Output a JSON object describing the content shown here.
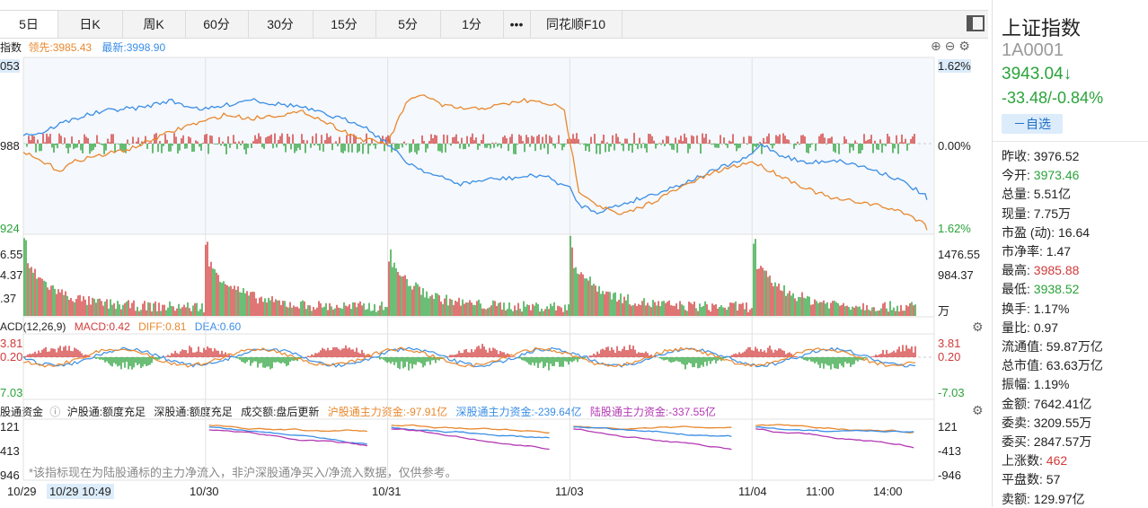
{
  "tabs": [
    "5日",
    "日K",
    "周K",
    "60分",
    "30分",
    "15分",
    "5分",
    "1分",
    "•••",
    "同花顺F10"
  ],
  "price_panel": {
    "legend_prefix": "指数",
    "lead_label": "领先:3985.43",
    "latest_label": "最新:3998.90",
    "y_left": [
      "053",
      "988",
      "924"
    ],
    "y_right": [
      "1.62%",
      "0.00%",
      "1.62%"
    ]
  },
  "volume_panel": {
    "y_left": [
      "6.55",
      "4.37",
      ".37"
    ],
    "y_right": [
      "1476.55",
      "984.37",
      "万"
    ],
    "unit": "万"
  },
  "macd_panel": {
    "title": "ACD(12,26,9)",
    "macd": "MACD:0.42",
    "diff": "DIFF:0.81",
    "dea": "DEA:0.60",
    "y_left": [
      "3.81",
      "0.20",
      "7.03"
    ],
    "y_right": [
      "3.81",
      "0.20",
      "-7.03"
    ]
  },
  "flow_panel": {
    "title": "股通资金",
    "sh_quota": "沪股通:额度充足",
    "sz_quota": "深股通:额度充足",
    "volume_note": "成交额:盘后更新",
    "sh_flow": "沪股通主力资金:-97.91亿",
    "sz_flow": "深股通主力资金:-239.64亿",
    "lgt_flow": "陆股通主力资金:-337.55亿",
    "y_left": [
      "121",
      "413",
      "946"
    ],
    "y_right": [
      "121",
      "-413",
      "-946"
    ],
    "note": "*该指标现在为陆股通标的主力净流入，非沪深股通净买入/净流入数据，仅供参考。"
  },
  "dates": [
    "10/29",
    "10/29 10:49",
    "10/30",
    "10/31",
    "11/03",
    "11/04",
    "11:00",
    "14:00"
  ],
  "quote": {
    "name": "上证指数",
    "code": "1A0001",
    "price": "3943.04↓",
    "change": "-33.48/-0.84%",
    "watch_button": "－自选",
    "stats": [
      {
        "label": "昨收:",
        "value": "3976.52",
        "tone": "plain"
      },
      {
        "label": "今开:",
        "value": "3973.46",
        "tone": "green"
      },
      {
        "label": "总量:",
        "value": "5.51亿",
        "tone": "plain"
      },
      {
        "label": "现量:",
        "value": "7.75万",
        "tone": "plain"
      },
      {
        "label": "市盈 (动):",
        "value": "16.64",
        "tone": "plain"
      },
      {
        "label": "市净率:",
        "value": "1.47",
        "tone": "plain"
      },
      {
        "label": "最高:",
        "value": "3985.88",
        "tone": "red"
      },
      {
        "label": "最低:",
        "value": "3938.52",
        "tone": "green"
      },
      {
        "label": "换手:",
        "value": "1.17%",
        "tone": "plain"
      },
      {
        "label": "量比:",
        "value": "0.97",
        "tone": "plain"
      },
      {
        "label": "流通值:",
        "value": "59.87万亿",
        "tone": "plain"
      },
      {
        "label": "总市值:",
        "value": "63.63万亿",
        "tone": "plain"
      },
      {
        "label": "振幅:",
        "value": "1.19%",
        "tone": "plain"
      },
      {
        "label": "金额:",
        "value": "7642.41亿",
        "tone": "plain"
      },
      {
        "label": "委卖:",
        "value": "3209.55万",
        "tone": "plain"
      },
      {
        "label": "委买:",
        "value": "2847.57万",
        "tone": "plain"
      },
      {
        "label": "上涨数:",
        "value": "462",
        "tone": "red"
      },
      {
        "label": "平盘数:",
        "value": "57",
        "tone": "plain"
      },
      {
        "label": "卖额:",
        "value": "129.97亿",
        "tone": "plain"
      }
    ]
  },
  "colors": {
    "up": "#d23a3a",
    "down": "#2aa33a",
    "latest": "#3a8ee6",
    "lead": "#e8882e",
    "lgt": "#b338b3"
  }
}
